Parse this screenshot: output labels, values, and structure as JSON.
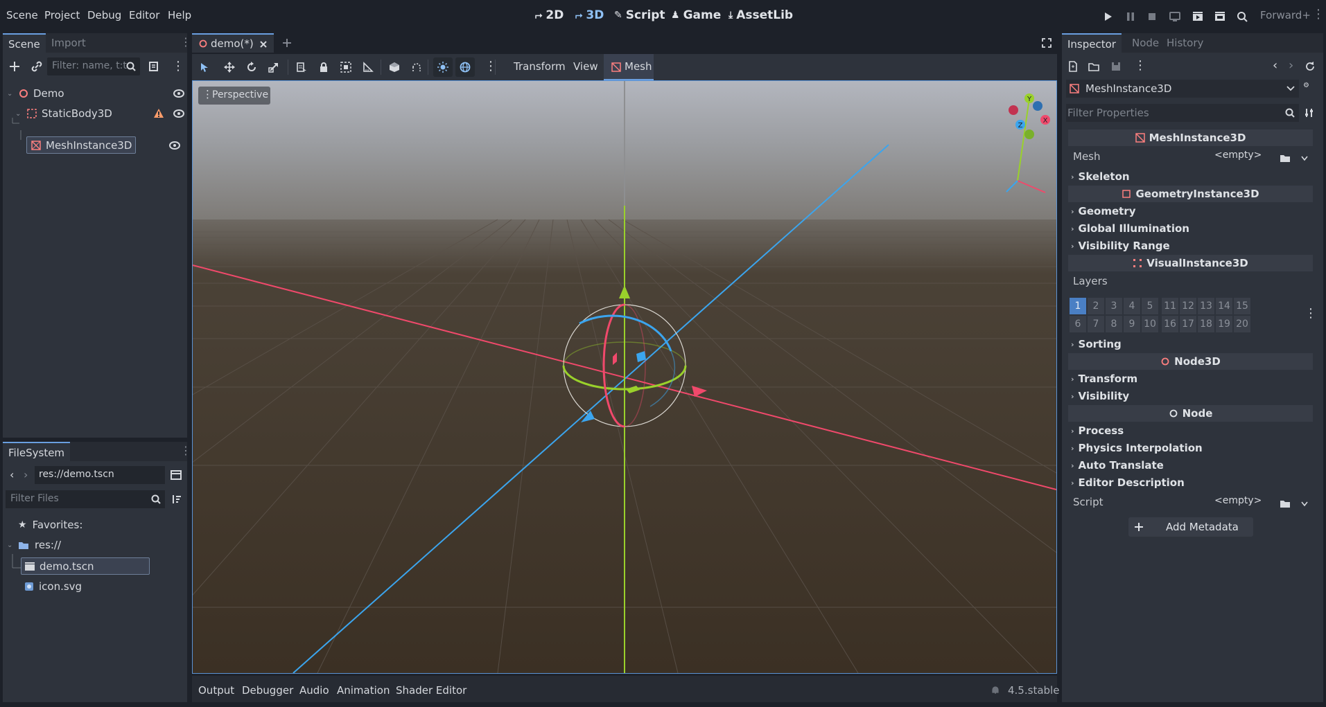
{
  "menubar": {
    "menus": [
      "Scene",
      "Project",
      "Debug",
      "Editor",
      "Help"
    ],
    "main_screens": [
      {
        "label": "2D",
        "icon": "2d-icon",
        "active": false
      },
      {
        "label": "3D",
        "icon": "3d-icon",
        "active": true
      },
      {
        "label": "Script",
        "icon": "script-icon",
        "active": false
      },
      {
        "label": "Game",
        "icon": "game-icon",
        "active": false
      },
      {
        "label": "AssetLib",
        "icon": "assetlib-icon",
        "active": false
      }
    ],
    "renderer": "Forward+"
  },
  "scene_dock": {
    "tabs": [
      "Scene",
      "Import"
    ],
    "filter_placeholder": "Filter: name, t:t",
    "tree": [
      {
        "label": "Demo",
        "icon": "node3d-icon",
        "depth": 0
      },
      {
        "label": "StaticBody3D",
        "icon": "staticbody-icon",
        "depth": 1,
        "warning": true
      },
      {
        "label": "MeshInstance3D",
        "icon": "meshinstance-icon",
        "depth": 2,
        "selected": true
      }
    ]
  },
  "filesystem_dock": {
    "tab": "FileSystem",
    "path": "res://demo.tscn",
    "filter_placeholder": "Filter Files",
    "favorites_label": "Favorites:",
    "root_label": "res://",
    "files": [
      {
        "label": "demo.tscn",
        "icon": "scene-file-icon",
        "selected": true
      },
      {
        "label": "icon.svg",
        "icon": "image-file-icon",
        "selected": false
      }
    ]
  },
  "editor_tabs": {
    "scene_tab": "demo(*)"
  },
  "viewport_toolbar": {
    "menus": [
      "Transform",
      "View",
      "Mesh"
    ],
    "active_menu": "Mesh",
    "perspective_label": "Perspective"
  },
  "gizmo_axes": {
    "x": "X",
    "y": "Y",
    "z": "Z"
  },
  "bottom_panel": {
    "tabs": [
      "Output",
      "Debugger",
      "Audio",
      "Animation",
      "Shader Editor"
    ],
    "version": "4.5.stable"
  },
  "inspector": {
    "tabs": [
      "Inspector",
      "Node",
      "History"
    ],
    "object_name": "MeshInstance3D",
    "filter_placeholder": "Filter Properties",
    "mesh_header": "MeshInstance3D",
    "mesh_label": "Mesh",
    "mesh_value": "<empty>",
    "skeleton": "Skeleton",
    "geometry_header": "GeometryInstance3D",
    "geometry": "Geometry",
    "global_illumination": "Global Illumination",
    "visibility_range": "Visibility Range",
    "visual_header": "VisualInstance3D",
    "layers_label": "Layers",
    "layers_row1": [
      "1",
      "2",
      "3",
      "4",
      "5",
      "11",
      "12",
      "13",
      "14",
      "15"
    ],
    "layers_row2": [
      "6",
      "7",
      "8",
      "9",
      "10",
      "16",
      "17",
      "18",
      "19",
      "20"
    ],
    "selected_layer": "1",
    "sorting": "Sorting",
    "node3d_header": "Node3D",
    "transform": "Transform",
    "visibility": "Visibility",
    "node_header": "Node",
    "process": "Process",
    "physics_interpolation": "Physics Interpolation",
    "auto_translate": "Auto Translate",
    "editor_description": "Editor Description",
    "script_label": "Script",
    "script_value": "<empty>",
    "add_metadata": "Add Metadata"
  },
  "colors": {
    "accent": "#6a9fe0",
    "x_axis": "#f0496b",
    "y_axis": "#9ad12b",
    "z_axis": "#3ba5ee",
    "ground": "#3b3024"
  }
}
